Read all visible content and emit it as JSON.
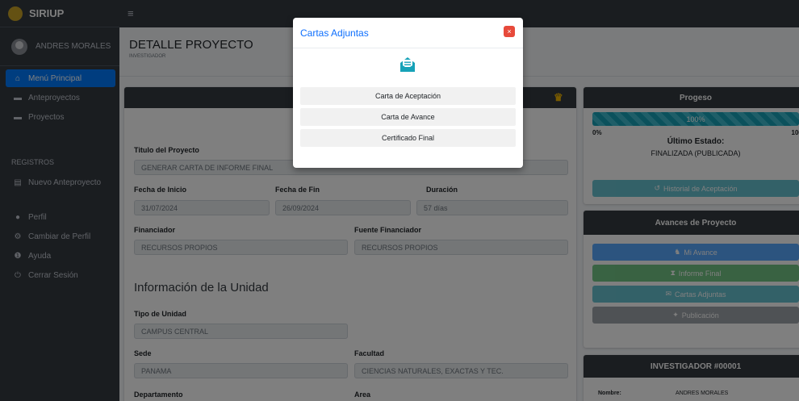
{
  "app": {
    "brand": "SIRIUP"
  },
  "topbar": {
    "menu_icon": "hamburger-icon"
  },
  "sidebar": {
    "user_name": "ANDRES MORALES",
    "items": [
      {
        "label": "Menú Principal",
        "icon": "home-icon",
        "active": true
      },
      {
        "label": "Anteproyectos",
        "icon": "projects-icon"
      },
      {
        "label": "Proyectos",
        "icon": "projects-icon"
      }
    ],
    "section_header": "REGISTROS",
    "register_items": [
      {
        "label": "Nuevo Anteproyecto",
        "icon": "document-icon"
      }
    ],
    "account_items": [
      {
        "label": "Perfil",
        "icon": "user-icon"
      },
      {
        "label": "Cambiar de Perfil",
        "icon": "settings-icon"
      },
      {
        "label": "Ayuda",
        "icon": "info-icon"
      },
      {
        "label": "Cerrar Sesión",
        "icon": "power-icon"
      }
    ]
  },
  "page": {
    "title": "DETALLE PROYECTO",
    "subtitle": "INVESTIGADOR"
  },
  "project": {
    "title_label": "Titulo del Proyecto",
    "title_value": "GENERAR CARTA DE INFORME FINAL",
    "start_label": "Fecha de Inicio",
    "start_value": "31/07/2024",
    "end_label": "Fecha de Fin",
    "end_value": "26/09/2024",
    "duration_label": "Duración",
    "duration_value": "57 días",
    "funder_label": "Financiador",
    "funder_value": "RECURSOS PROPIOS",
    "source_label": "Fuente Financiador",
    "source_value": "RECURSOS PROPIOS"
  },
  "unit": {
    "section_title": "Información de la Unidad",
    "type_label": "Tipo de Unidad",
    "type_value": "CAMPUS CENTRAL",
    "site_label": "Sede",
    "site_value": "PANAMA",
    "faculty_label": "Facultad",
    "faculty_value": "CIENCIAS NATURALES, EXACTAS Y TEC.",
    "department_label": "Departamento",
    "area_label": "Area"
  },
  "progress_card": {
    "title": "Progeso",
    "bar_text": "100%",
    "bar_fraction": 1.0,
    "min_label": "0%",
    "max_label": "100%",
    "state_label": "Último Estado:",
    "state_value": "FINALIZADA (PUBLICADA)",
    "history_button": "Historial de Aceptación"
  },
  "advances_card": {
    "title": "Avances de Proyecto",
    "buttons": [
      {
        "label": "Mi Avance",
        "color": "#007bff"
      },
      {
        "label": "Informe Final",
        "color": "#28a745"
      },
      {
        "label": "Cartas Adjuntas",
        "color": "#17a2b8"
      },
      {
        "label": "Publicación",
        "color": "#6c757d"
      }
    ]
  },
  "investigator_card": {
    "title": "INVESTIGADOR #00001",
    "name_label": "Nombre:",
    "name_value": "ANDRES MORALES"
  },
  "modal": {
    "title": "Cartas Adjuntas",
    "close": "×",
    "items": [
      "Carta de Aceptación",
      "Carta de Avance",
      "Certificado Final"
    ]
  },
  "colors": {
    "primary": "#007bff",
    "info": "#17a2b8",
    "success": "#28a745",
    "secondary": "#6c757d",
    "sidebar": "#343a40",
    "danger": "#e74a3b"
  }
}
